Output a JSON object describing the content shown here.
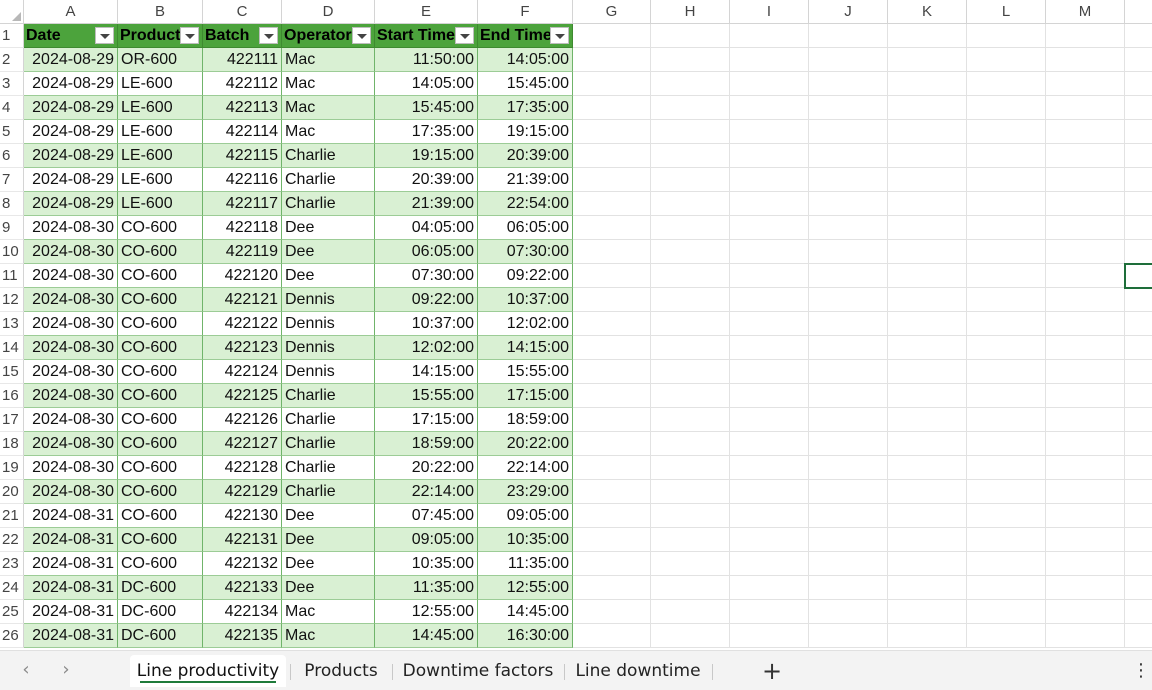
{
  "columns": [
    "A",
    "B",
    "C",
    "D",
    "E",
    "F",
    "G",
    "H",
    "I",
    "J",
    "K",
    "L",
    "M"
  ],
  "table": {
    "headers": [
      "Date",
      "Product",
      "Batch",
      "Operator",
      "Start Time",
      "End Time"
    ],
    "rows": [
      [
        "2024-08-29",
        "OR-600",
        "422111",
        "Mac",
        "11:50:00",
        "14:05:00"
      ],
      [
        "2024-08-29",
        "LE-600",
        "422112",
        "Mac",
        "14:05:00",
        "15:45:00"
      ],
      [
        "2024-08-29",
        "LE-600",
        "422113",
        "Mac",
        "15:45:00",
        "17:35:00"
      ],
      [
        "2024-08-29",
        "LE-600",
        "422114",
        "Mac",
        "17:35:00",
        "19:15:00"
      ],
      [
        "2024-08-29",
        "LE-600",
        "422115",
        "Charlie",
        "19:15:00",
        "20:39:00"
      ],
      [
        "2024-08-29",
        "LE-600",
        "422116",
        "Charlie",
        "20:39:00",
        "21:39:00"
      ],
      [
        "2024-08-29",
        "LE-600",
        "422117",
        "Charlie",
        "21:39:00",
        "22:54:00"
      ],
      [
        "2024-08-30",
        "CO-600",
        "422118",
        "Dee",
        "04:05:00",
        "06:05:00"
      ],
      [
        "2024-08-30",
        "CO-600",
        "422119",
        "Dee",
        "06:05:00",
        "07:30:00"
      ],
      [
        "2024-08-30",
        "CO-600",
        "422120",
        "Dee",
        "07:30:00",
        "09:22:00"
      ],
      [
        "2024-08-30",
        "CO-600",
        "422121",
        "Dennis",
        "09:22:00",
        "10:37:00"
      ],
      [
        "2024-08-30",
        "CO-600",
        "422122",
        "Dennis",
        "10:37:00",
        "12:02:00"
      ],
      [
        "2024-08-30",
        "CO-600",
        "422123",
        "Dennis",
        "12:02:00",
        "14:15:00"
      ],
      [
        "2024-08-30",
        "CO-600",
        "422124",
        "Dennis",
        "14:15:00",
        "15:55:00"
      ],
      [
        "2024-08-30",
        "CO-600",
        "422125",
        "Charlie",
        "15:55:00",
        "17:15:00"
      ],
      [
        "2024-08-30",
        "CO-600",
        "422126",
        "Charlie",
        "17:15:00",
        "18:59:00"
      ],
      [
        "2024-08-30",
        "CO-600",
        "422127",
        "Charlie",
        "18:59:00",
        "20:22:00"
      ],
      [
        "2024-08-30",
        "CO-600",
        "422128",
        "Charlie",
        "20:22:00",
        "22:14:00"
      ],
      [
        "2024-08-30",
        "CO-600",
        "422129",
        "Charlie",
        "22:14:00",
        "23:29:00"
      ],
      [
        "2024-08-31",
        "CO-600",
        "422130",
        "Dee",
        "07:45:00",
        "09:05:00"
      ],
      [
        "2024-08-31",
        "CO-600",
        "422131",
        "Dee",
        "09:05:00",
        "10:35:00"
      ],
      [
        "2024-08-31",
        "CO-600",
        "422132",
        "Dee",
        "10:35:00",
        "11:35:00"
      ],
      [
        "2024-08-31",
        "DC-600",
        "422133",
        "Dee",
        "11:35:00",
        "12:55:00"
      ],
      [
        "2024-08-31",
        "DC-600",
        "422134",
        "Mac",
        "12:55:00",
        "14:45:00"
      ],
      [
        "2024-08-31",
        "DC-600",
        "422135",
        "Mac",
        "14:45:00",
        "16:30:00"
      ]
    ]
  },
  "selected_cell": "N11",
  "sheet_tabs": [
    "Line productivity",
    "Products",
    "Downtime factors",
    "Line downtime"
  ],
  "active_sheet": "Line productivity",
  "icons": {
    "prev_sheet": "chevron-left-icon",
    "next_sheet": "chevron-right-icon",
    "add_sheet": "plus-icon",
    "more_options": "vertical-ellipsis-icon",
    "filter": "filter-dropdown-icon"
  },
  "colors": {
    "table_header": "#4ca33c",
    "table_band": "#d9f0d3",
    "selection": "#1e6e3a",
    "active_tab_underline": "#1e7a3a"
  }
}
